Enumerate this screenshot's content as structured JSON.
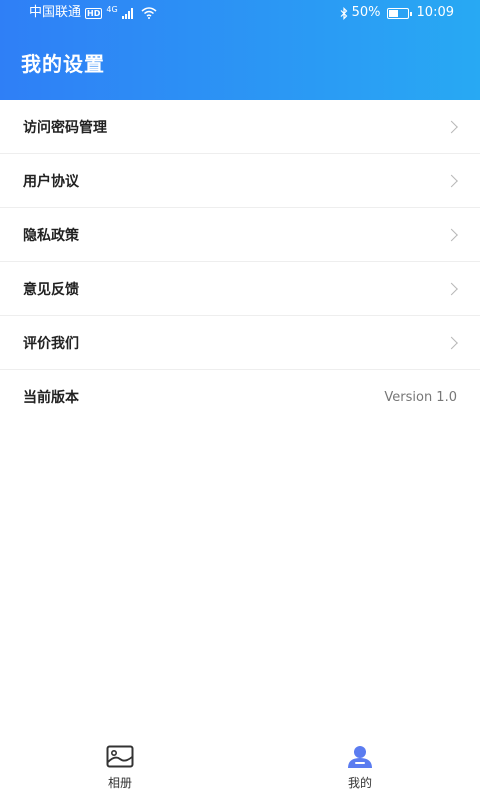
{
  "status_bar": {
    "carrier": "中国联通",
    "hd": "HD",
    "network": "4G",
    "battery": "50%",
    "battery_level": 0.5,
    "time": "10:09"
  },
  "header": {
    "title": "我的设置"
  },
  "settings": {
    "items": [
      {
        "label": "访问密码管理"
      },
      {
        "label": "用户协议"
      },
      {
        "label": "隐私政策"
      },
      {
        "label": "意见反馈"
      },
      {
        "label": "评价我们"
      },
      {
        "label": "当前版本",
        "value": "Version 1.0"
      }
    ]
  },
  "tab_bar": {
    "tabs": [
      {
        "label": "相册",
        "icon": "photo-album-icon"
      },
      {
        "label": "我的",
        "icon": "user-profile-icon",
        "active": true
      }
    ]
  },
  "colors": {
    "header_start": "#2f7ff6",
    "header_end": "#28a9f3",
    "active_tab_icon": "#5b7cf0"
  }
}
